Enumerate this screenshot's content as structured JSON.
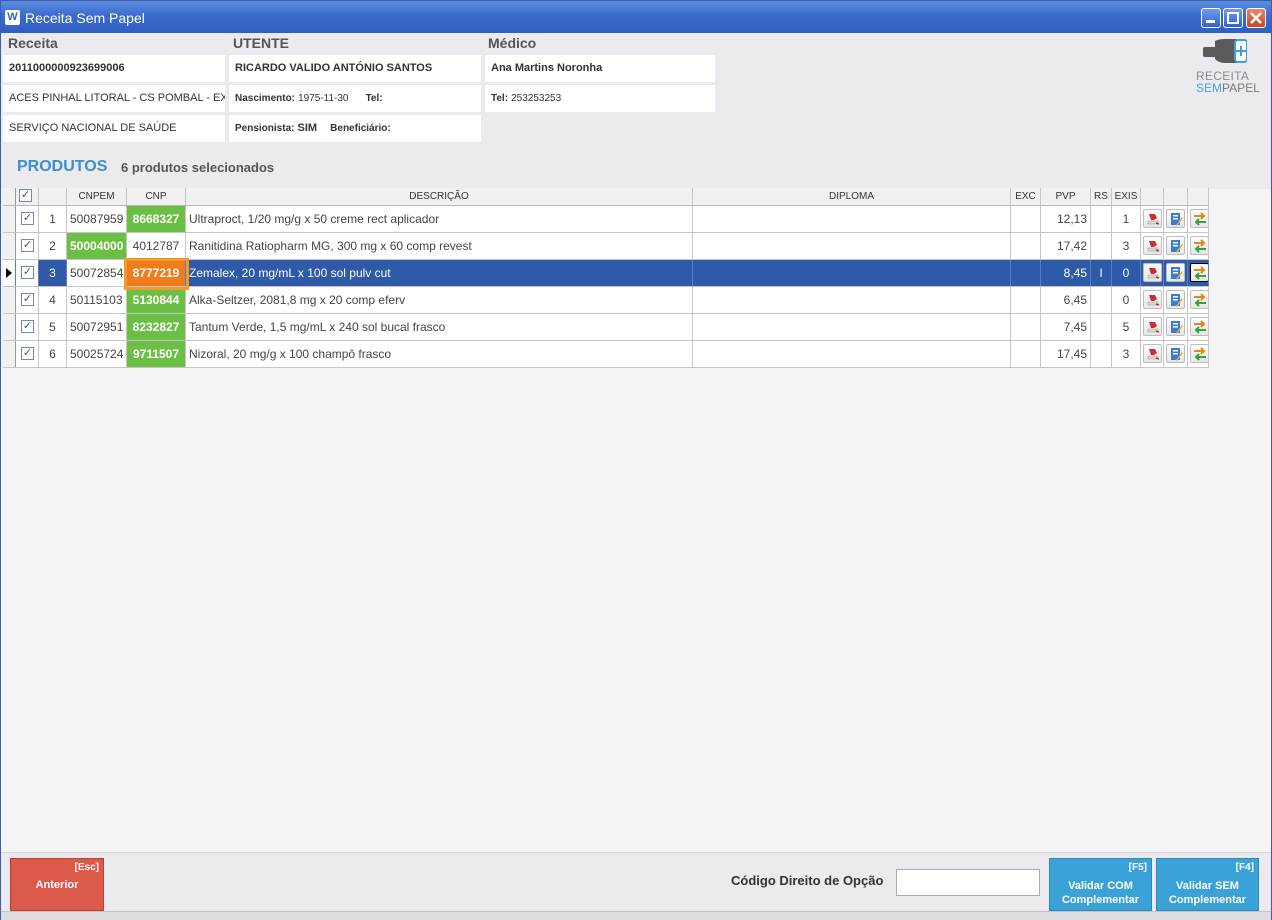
{
  "window": {
    "title": "Receita Sem Papel",
    "app_icon": "W"
  },
  "receita": {
    "label": "Receita",
    "number": "2011000000923699006",
    "local": "ACES PINHAL LITORAL - CS POMBAL - EXT",
    "entidade": "SERVIÇO NACIONAL DE SAÚDE"
  },
  "utente": {
    "label": "UTENTE",
    "name": "RICARDO VALIDO ANTÓNIO SANTOS",
    "nascimento_label": "Nascimento:",
    "nascimento": "1975-11-30",
    "tel_label": "Tel:",
    "tel": "",
    "pensionista_label": "Pensionista:",
    "pensionista": "SIM",
    "beneficiario_label": "Beneficiário:",
    "beneficiario": ""
  },
  "medico": {
    "label": "Médico",
    "name": "Ana Martins Noronha",
    "tel_label": "Tel:",
    "tel": "253253253"
  },
  "logo": {
    "line1": "RECEITA",
    "line2a": "SEM",
    "line2b": "PAPEL"
  },
  "produtos": {
    "title": "PRODUTOS",
    "count": "6 produtos selecionados"
  },
  "grid": {
    "headers": {
      "cnpem": "CNPEM",
      "cnp": "CNP",
      "descricao": "DESCRIÇÃO",
      "diploma": "DIPLOMA",
      "exc": "EXC",
      "pvp": "PVP",
      "rs": "RS",
      "exis": "EXIS"
    },
    "rows": [
      {
        "num": "1",
        "cnpem": "50087959",
        "cnp": "8668327",
        "descricao": "Ultraproct, 1/20 mg/g x 50 creme rect aplicador",
        "pvp": "12,13",
        "rs": "",
        "exis": "1"
      },
      {
        "num": "2",
        "cnpem": "50004000",
        "cnp": "4012787",
        "descricao": "Ranitidina Ratiopharm MG, 300 mg x 60 comp revest",
        "pvp": "17,42",
        "rs": "",
        "exis": "3"
      },
      {
        "num": "3",
        "cnpem": "50072854",
        "cnp": "8777219",
        "descricao": "Zemalex, 20 mg/mL x 100 sol pulv cut",
        "pvp": "8,45",
        "rs": "I",
        "exis": "0"
      },
      {
        "num": "4",
        "cnpem": "50115103",
        "cnp": "5130844",
        "descricao": "Alka-Seltzer, 2081,8 mg x 20 comp eferv",
        "pvp": "6,45",
        "rs": "",
        "exis": "0"
      },
      {
        "num": "5",
        "cnpem": "50072951",
        "cnp": "8232827",
        "descricao": "Tantum Verde, 1,5 mg/mL x 240 sol bucal frasco",
        "pvp": "7,45",
        "rs": "",
        "exis": "5"
      },
      {
        "num": "6",
        "cnpem": "50025724",
        "cnp": "9711507",
        "descricao": "Nizoral, 20 mg/g x 100 champô frasco",
        "pvp": "17,45",
        "rs": "",
        "exis": "3"
      }
    ]
  },
  "footer": {
    "anterior_key": "[Esc]",
    "anterior_label": "Anterior",
    "cdo_label": "Código Direito de Opção",
    "cdo_value": "",
    "validar_com_key": "[F5]",
    "validar_com_line1": "Validar COM",
    "validar_com_line2": "Complementar",
    "validar_sem_key": "[F4]",
    "validar_sem_line1": "Validar SEM",
    "validar_sem_line2": "Complementar"
  },
  "colors": {
    "accent": "#3a8fd0",
    "selection": "#2f5aa8",
    "green": "#6cbf45",
    "orange": "#f07d1c",
    "red_button": "#dc5a4a",
    "blue_button": "#3aa2d6"
  },
  "icons": {
    "action1": "stamp-icon",
    "action2": "document-pen-icon",
    "action3": "swap-arrows-icon"
  }
}
